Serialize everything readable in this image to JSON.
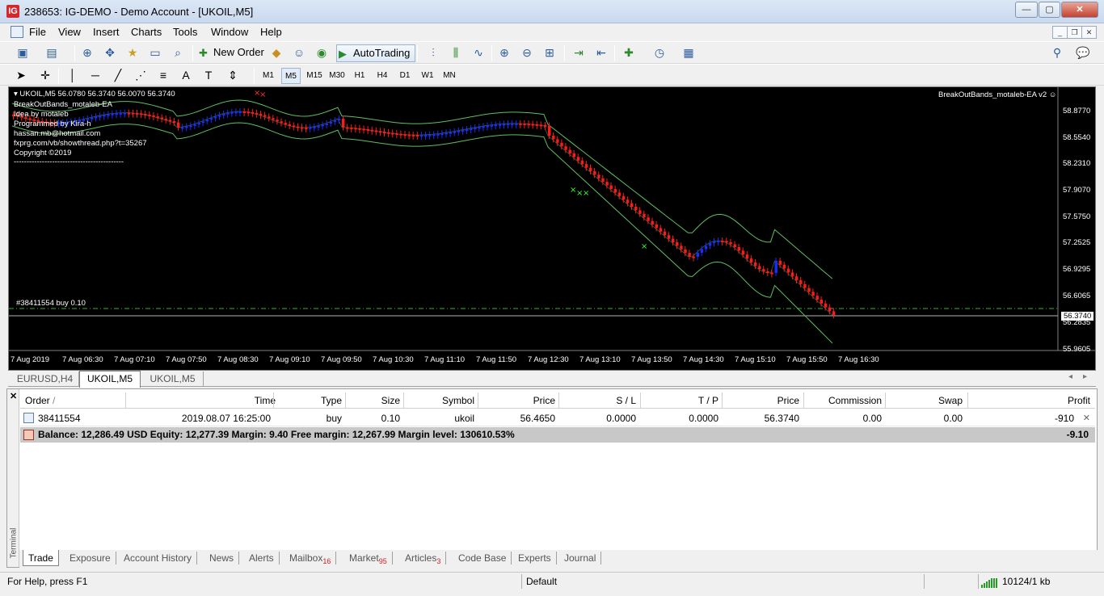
{
  "window": {
    "title": "238653: IG-DEMO - Demo Account - [UKOIL,M5]",
    "app_icon": "IG",
    "controls": {
      "minimize": "—",
      "maximize": "▢",
      "close": "✕"
    }
  },
  "menu": {
    "items": [
      "File",
      "View",
      "Insert",
      "Charts",
      "Tools",
      "Window",
      "Help"
    ],
    "mdi": {
      "minimize": "_",
      "restore": "❐",
      "close": "✕"
    }
  },
  "toolbar": {
    "new_order_label": "New Order",
    "autotrading_label": "AutoTrading",
    "timeframes": [
      "M1",
      "M5",
      "M15",
      "M30",
      "H1",
      "H4",
      "D1",
      "W1",
      "MN"
    ],
    "active_timeframe": "M5"
  },
  "chart": {
    "ohlc": "UKOIL,M5  56.0780 56.3740 56.0070 56.3740",
    "ea_name": "BreakOutBands_motaleb-EA v2",
    "info_lines": [
      "BreakOutBands_motaleb-EA",
      "Idea by motaleb",
      "Programmed by Kira-h",
      "hassan.mb@hotmail.com",
      "fxprg.com/vb/showthread.php?t=35267",
      "Copyright ©2019",
      "-------------------------------------------"
    ],
    "order_line_label": "#38411554 buy 0.10",
    "price_ticks": [
      "58.8770",
      "58.5540",
      "58.2310",
      "57.9070",
      "57.5750",
      "57.2525",
      "56.9295",
      "56.6065",
      "56.2835",
      "55.9605"
    ],
    "current_price": "56.3740",
    "time_ticks": [
      "7 Aug 2019",
      "7 Aug 06:30",
      "7 Aug 07:10",
      "7 Aug 07:50",
      "7 Aug 08:30",
      "7 Aug 09:10",
      "7 Aug 09:50",
      "7 Aug 10:30",
      "7 Aug 11:10",
      "7 Aug 11:50",
      "7 Aug 12:30",
      "7 Aug 13:10",
      "7 Aug 13:50",
      "7 Aug 14:30",
      "7 Aug 15:10",
      "7 Aug 15:50",
      "7 Aug 16:30"
    ],
    "colors": {
      "bull": "#1a2cff",
      "bear": "#ff1a1a",
      "bands": "#5fbf5f",
      "order_line": "#32b432",
      "bid_line": "#b4b4b4",
      "arrow_sell": "#ff3030",
      "arrow_buy": "#30ff30"
    }
  },
  "chart_tabs": {
    "items": [
      "EURUSD,H4",
      "UKOIL,M5",
      "UKOIL,M5"
    ],
    "active_index": 1,
    "left_arrow": "◂",
    "right_arrow": "▸"
  },
  "terminal": {
    "side_label": "Terminal",
    "close": "✕",
    "columns": {
      "order": "Order",
      "sort": "/",
      "time": "Time",
      "type": "Type",
      "size": "Size",
      "symbol": "Symbol",
      "price": "Price",
      "sl": "S / L",
      "tp": "T / P",
      "price2": "Price",
      "commission": "Commission",
      "swap": "Swap",
      "profit": "Profit"
    },
    "row": {
      "order": "38411554",
      "time": "2019.08.07 16:25:00",
      "type": "buy",
      "size": "0.10",
      "symbol": "ukoil",
      "price": "56.4650",
      "sl": "0.0000",
      "tp": "0.0000",
      "price2": "56.3740",
      "commission": "0.00",
      "swap": "0.00",
      "profit": "-910",
      "close": "✕"
    },
    "balance": {
      "text": "Balance: 12,286.49 USD  Equity: 12,277.39  Margin: 9.40  Free margin: 12,267.99  Margin level: 130610.53%",
      "profit": "-9.10"
    },
    "tabs": [
      {
        "label": "Trade",
        "badge": ""
      },
      {
        "label": "Exposure",
        "badge": ""
      },
      {
        "label": "Account History",
        "badge": ""
      },
      {
        "label": "News",
        "badge": ""
      },
      {
        "label": "Alerts",
        "badge": ""
      },
      {
        "label": "Mailbox",
        "badge": "16"
      },
      {
        "label": "Market",
        "badge": "95"
      },
      {
        "label": "Articles",
        "badge": "3"
      },
      {
        "label": "Code Base",
        "badge": ""
      },
      {
        "label": "Experts",
        "badge": ""
      },
      {
        "label": "Journal",
        "badge": ""
      }
    ]
  },
  "status": {
    "help": "For Help, press F1",
    "profile": "Default",
    "traffic": "10124/1 kb"
  }
}
